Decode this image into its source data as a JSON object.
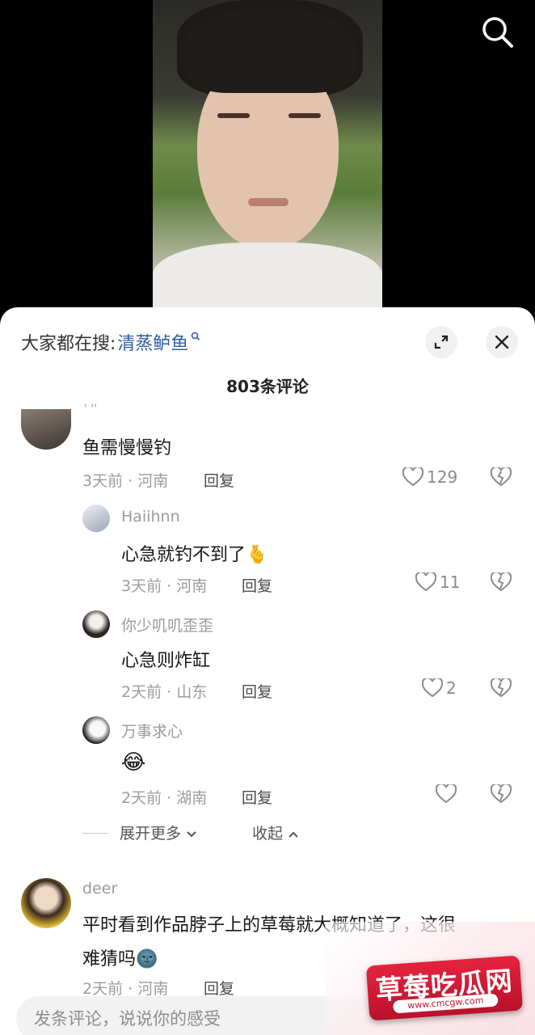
{
  "video": {},
  "sheet": {
    "hot_search_prefix": "大家都在搜:",
    "hot_search_keyword": "清蒸鲈鱼",
    "comment_count_title": "803条评论"
  },
  "comments": [
    {
      "username": "' ''",
      "text": "鱼需慢慢钓",
      "meta": "3天前 · 河南",
      "reply_label": "回复",
      "likes": "129"
    },
    {
      "username": "Haiihnn",
      "text": "心急就钓不到了",
      "emoji": "🫰",
      "meta": "3天前 · 河南",
      "reply_label": "回复",
      "likes": "11"
    },
    {
      "username": "你少叽叽歪歪",
      "text": "心急则炸缸",
      "meta": "2天前 · 山东",
      "reply_label": "回复",
      "likes": "2"
    },
    {
      "username": "万事求心",
      "text": "😂",
      "meta": "2天前 · 湖南",
      "reply_label": "回复",
      "likes": ""
    },
    {
      "username": "deer",
      "text_line1": "平时看到作品脖子上的草莓就大概知道了，这很",
      "text_line2": "难猜吗",
      "emoji": "🌚",
      "meta": "2天前 · 河南",
      "reply_label": "回复"
    }
  ],
  "expand": {
    "more_label": "展开更多",
    "collapse_label": "收起"
  },
  "input": {
    "placeholder": "发条评论，说说你的感受"
  },
  "watermark": {
    "title": "草莓吃瓜网",
    "url": "www.cmcgw.com"
  },
  "colors": {
    "keyword": "#2f5ea8",
    "meta": "#9c9ca1",
    "watermark": "#d41a34"
  }
}
